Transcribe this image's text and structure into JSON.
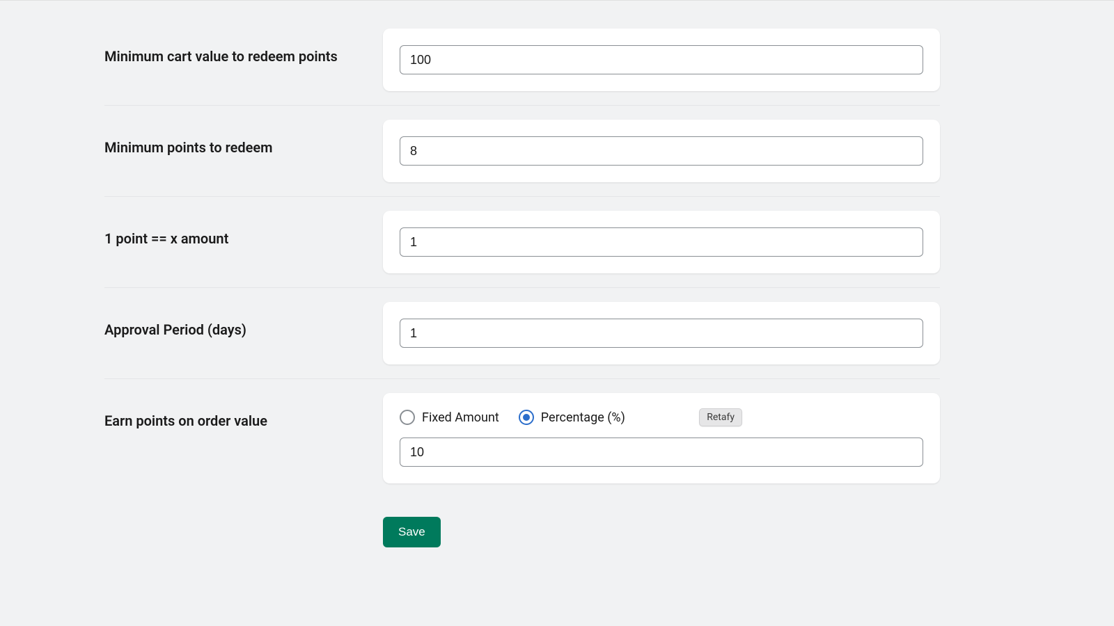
{
  "fields": {
    "min_cart": {
      "label": "Minimum cart value to redeem points",
      "value": "100"
    },
    "min_points": {
      "label": "Minimum points to redeem",
      "value": "8"
    },
    "point_amount": {
      "label": "1 point == x amount",
      "value": "1"
    },
    "approval_period": {
      "label": "Approval Period (days)",
      "value": "1"
    },
    "earn_points": {
      "label": "Earn points on order value",
      "option_fixed": "Fixed Amount",
      "option_percentage": "Percentage (%)",
      "value": "10"
    }
  },
  "badge": "Retafy",
  "save_label": "Save"
}
